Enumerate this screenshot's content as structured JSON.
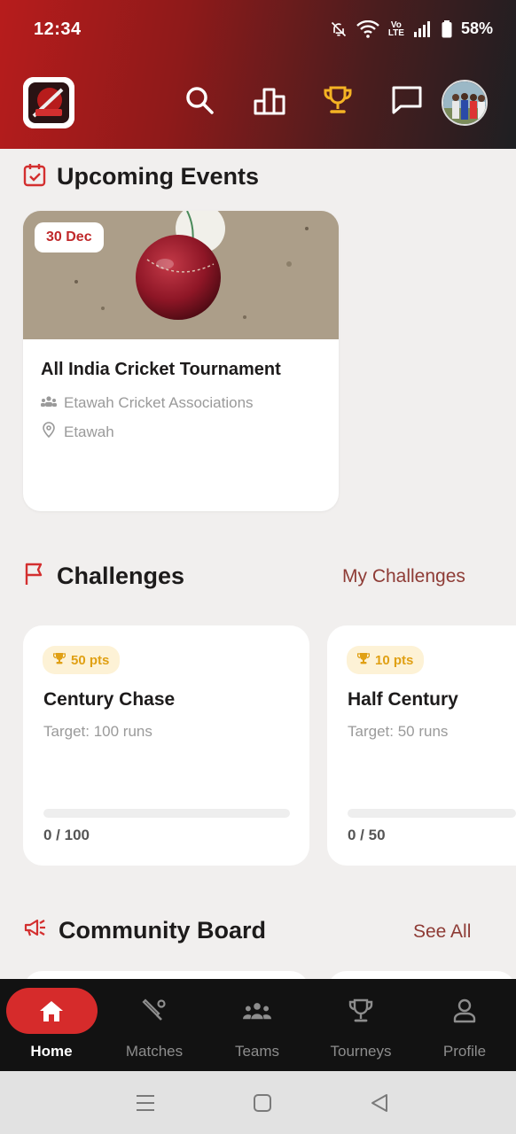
{
  "status_bar": {
    "time": "12:34",
    "volte_line1": "Vo",
    "volte_line2": "LTE",
    "battery": "58%"
  },
  "header": {
    "icons": [
      "search-icon",
      "leaderboard-icon",
      "trophy-icon",
      "chat-icon"
    ],
    "active_icon_color": "#f5b324"
  },
  "upcoming": {
    "title": "Upcoming Events",
    "event": {
      "date": "30 Dec",
      "title": "All India Cricket Tournament",
      "organizer": "Etawah Cricket Associations",
      "location": "Etawah"
    }
  },
  "challenges": {
    "title": "Challenges",
    "link": "My Challenges",
    "items": [
      {
        "points": "50 pts",
        "title": "Century Chase",
        "target": "Target: 100 runs",
        "progress_text": "0 / 100",
        "progress": 0
      },
      {
        "points": "10 pts",
        "title": "Half Century",
        "target": "Target: 50 runs",
        "progress_text": "0 / 50",
        "progress": 0
      }
    ]
  },
  "community": {
    "title": "Community Board",
    "link": "See All"
  },
  "nav": {
    "items": [
      {
        "label": "Home",
        "icon": "home-icon",
        "active": true
      },
      {
        "label": "Matches",
        "icon": "cricket-bat-icon",
        "active": false
      },
      {
        "label": "Teams",
        "icon": "group-icon",
        "active": false
      },
      {
        "label": "Tourneys",
        "icon": "trophy-icon",
        "active": false
      },
      {
        "label": "Profile",
        "icon": "person-icon",
        "active": false
      }
    ]
  },
  "colors": {
    "accent": "#c0292b",
    "link": "#8e3b35",
    "points": "#e0a014"
  }
}
